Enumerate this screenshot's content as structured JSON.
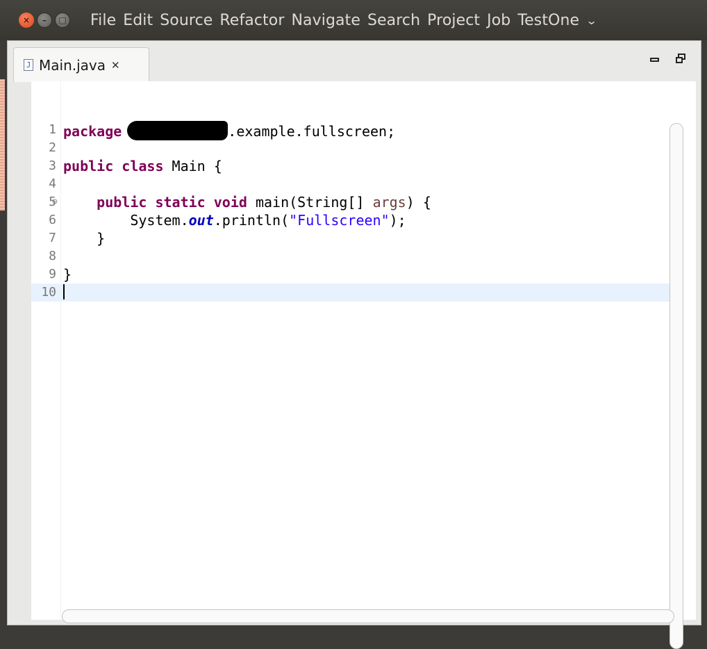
{
  "menubar": {
    "window_buttons": [
      "close",
      "minimize",
      "maximize"
    ],
    "items": [
      "File",
      "Edit",
      "Source",
      "Refactor",
      "Navigate",
      "Search",
      "Project",
      "Job",
      "TestOne"
    ],
    "overflow_icon": "chevron-down-icon"
  },
  "editor_tab": {
    "label": "Main.java",
    "close_glyph": "✕",
    "file_icon_glyph": "J"
  },
  "code": {
    "lines": [
      {
        "num": "1",
        "tokens": [
          [
            "kw",
            "package"
          ],
          [
            "redact",
            ""
          ],
          [
            "plain",
            ".example.fullscreen;"
          ]
        ]
      },
      {
        "num": "2",
        "tokens": []
      },
      {
        "num": "3",
        "tokens": [
          [
            "kw",
            "public"
          ],
          [
            "plain",
            " "
          ],
          [
            "kw",
            "class"
          ],
          [
            "plain",
            " Main {"
          ]
        ]
      },
      {
        "num": "4",
        "tokens": []
      },
      {
        "num": "5",
        "fold": "⊖",
        "tokens": [
          [
            "plain",
            "    "
          ],
          [
            "kw",
            "public"
          ],
          [
            "plain",
            " "
          ],
          [
            "kw",
            "static"
          ],
          [
            "plain",
            " "
          ],
          [
            "kw",
            "void"
          ],
          [
            "plain",
            " main(String[] "
          ],
          [
            "param",
            "args"
          ],
          [
            "plain",
            ") {"
          ]
        ]
      },
      {
        "num": "6",
        "tokens": [
          [
            "plain",
            "        System."
          ],
          [
            "fld",
            "out"
          ],
          [
            "plain",
            ".println("
          ],
          [
            "str",
            "\"Fullscreen\""
          ],
          [
            "plain",
            ");"
          ]
        ]
      },
      {
        "num": "7",
        "tokens": [
          [
            "plain",
            "    }"
          ]
        ]
      },
      {
        "num": "8",
        "tokens": []
      },
      {
        "num": "9",
        "tokens": [
          [
            "plain",
            "}"
          ]
        ]
      },
      {
        "num": "10",
        "current": true,
        "tokens": [
          [
            "caret",
            ""
          ]
        ]
      }
    ]
  },
  "colors": {
    "keyword": "#7f0055",
    "string": "#2a00ff",
    "field": "#0000c0",
    "current_line": "#e8f2fe"
  }
}
